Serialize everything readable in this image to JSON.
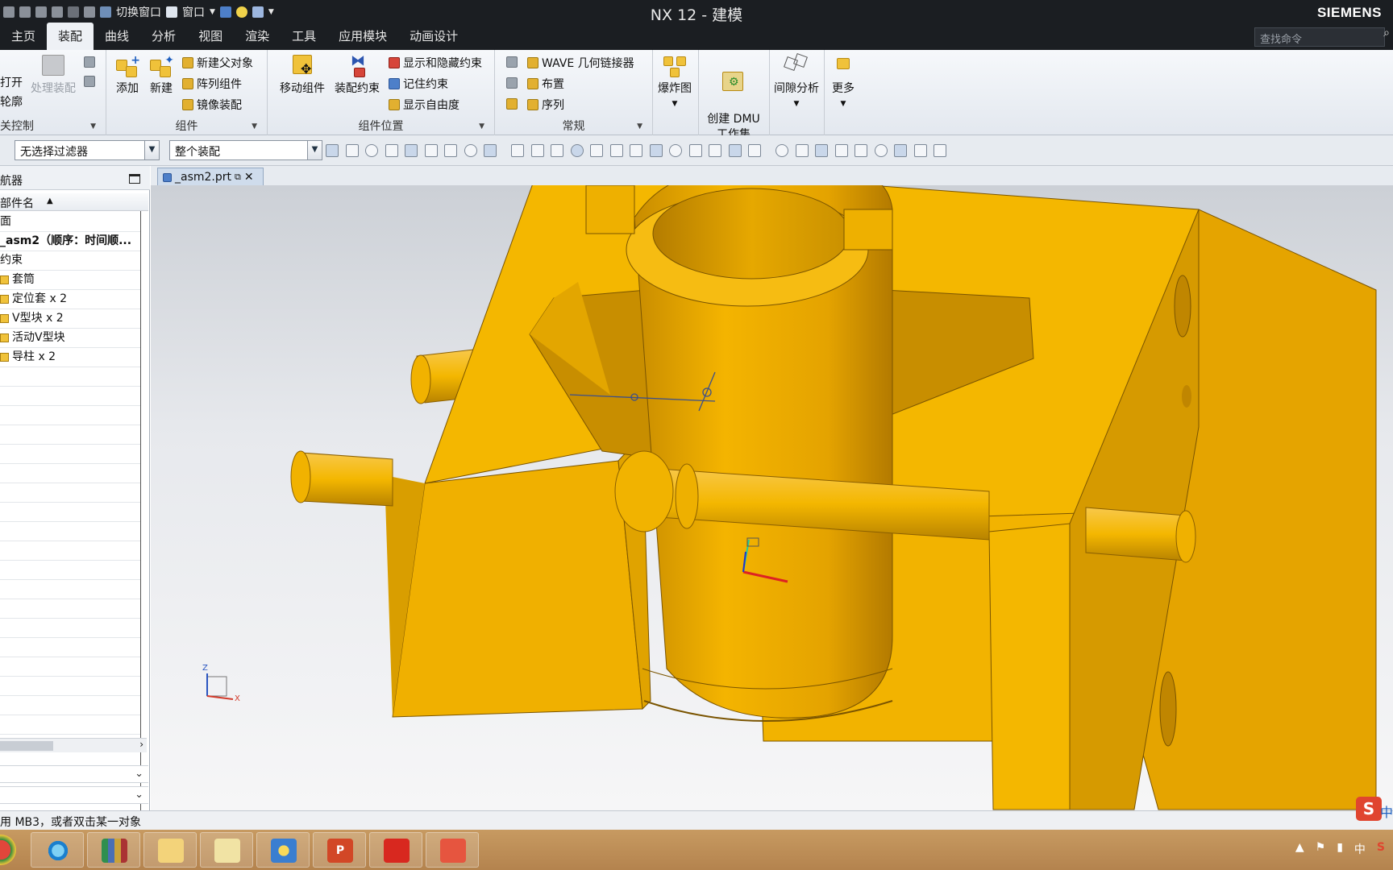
{
  "window": {
    "title": "NX 12 - 建模",
    "brand": "SIEMENS",
    "quick_access": {
      "switch_window": "切换窗口",
      "window_menu": "窗口"
    }
  },
  "menu": {
    "tabs": [
      "主页",
      "装配",
      "曲线",
      "分析",
      "视图",
      "渲染",
      "工具",
      "应用模块",
      "动画设计"
    ],
    "active_index": 1,
    "search_placeholder": "查找命令"
  },
  "ribbon": {
    "groups": {
      "control": {
        "label": "关控制",
        "items": [
          "打开",
          "轮廓",
          "处理装配"
        ]
      },
      "component": {
        "label": "组件",
        "big": [
          "添加",
          "新建"
        ],
        "small": [
          "新建父对象",
          "阵列组件",
          "镜像装配"
        ]
      },
      "position": {
        "label": "组件位置",
        "big": [
          "移动组件",
          "装配约束"
        ],
        "small": [
          "显示和隐藏约束",
          "记住约束",
          "显示自由度"
        ]
      },
      "general": {
        "label": "常规",
        "small": [
          "WAVE 几何链接器",
          "布置",
          "序列"
        ]
      },
      "extra": [
        "爆炸图",
        "创建 DMU\n工作集",
        "间隙分析",
        "更多"
      ]
    }
  },
  "selection_bar": {
    "filter": "无选择过滤器",
    "scope": "整个装配"
  },
  "navigator": {
    "title": "航器",
    "column": "部件名",
    "rows": [
      {
        "label": "面",
        "icon": false,
        "bold": false
      },
      {
        "label": "_asm2（顺序：时间顺...",
        "icon": false,
        "bold": true
      },
      {
        "label": "约束",
        "icon": false,
        "bold": false
      },
      {
        "label": "套筒",
        "icon": true,
        "bold": false
      },
      {
        "label": "定位套 x 2",
        "icon": true,
        "bold": false
      },
      {
        "label": "V型块 x 2",
        "icon": true,
        "bold": false
      },
      {
        "label": "活动V型块",
        "icon": true,
        "bold": false
      },
      {
        "label": "导柱 x 2",
        "icon": true,
        "bold": false
      }
    ]
  },
  "document": {
    "tab": "_asm2.prt"
  },
  "viewport": {
    "triad": {
      "x": "X",
      "z": "Z"
    },
    "model_color": "#f4b700"
  },
  "status": {
    "message": "用 MB3，或者双击某一对象"
  },
  "taskbar": {
    "ime": "中"
  }
}
